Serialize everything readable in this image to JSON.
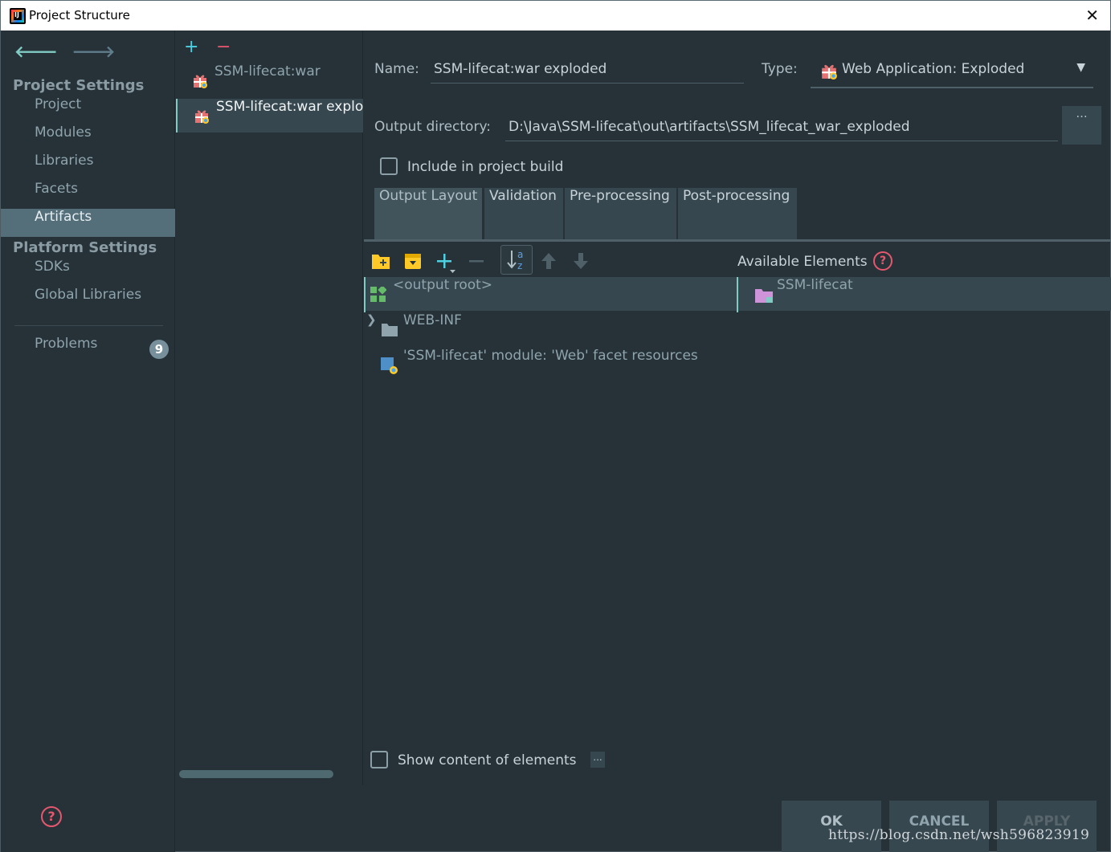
{
  "window": {
    "title": "Project Structure"
  },
  "sidebar": {
    "project_settings_title": "Project Settings",
    "project_items": [
      "Project",
      "Modules",
      "Libraries",
      "Facets",
      "Artifacts"
    ],
    "selected": "Artifacts",
    "platform_settings_title": "Platform Settings",
    "platform_items": [
      "SDKs",
      "Global Libraries"
    ],
    "problems_label": "Problems",
    "problems_count": "9"
  },
  "artifacts": {
    "add_glyph": "+",
    "remove_glyph": "−",
    "items": [
      "SSM-lifecat:war",
      "SSM-lifecat:war exploded"
    ]
  },
  "form": {
    "name_label": "Name:",
    "name_value": "SSM-lifecat:war exploded",
    "type_label": "Type:",
    "type_value": "Web Application: Exploded",
    "output_dir_label": "Output directory:",
    "output_dir_value": "D:\\Java\\SSM-lifecat\\out\\artifacts\\SSM_lifecat_war_exploded",
    "browse_label": "...",
    "include_label": "Include in project build",
    "include_checked": false
  },
  "tabs": [
    "Output Layout",
    "Validation",
    "Pre-processing",
    "Post-processing"
  ],
  "active_tab": "Output Layout",
  "layout": {
    "available_label": "Available Elements",
    "tree": [
      "<output root>",
      "WEB-INF",
      "'SSM-lifecat' module: 'Web' facet resources"
    ],
    "available": [
      "SSM-lifecat"
    ],
    "show_content_label": "Show content of elements",
    "show_content_checked": false,
    "dots_label": "..."
  },
  "buttons": {
    "ok": "OK",
    "cancel": "CANCEL",
    "apply": "APPLY"
  },
  "watermark": "https://blog.csdn.net/wsh596823919",
  "colors": {
    "background": "#263238",
    "selection": "#546e7a",
    "accent": "#80cbc4",
    "help_red": "#e5576e",
    "folder_yellow": "#ffca28",
    "folder_grey": "#90a4ae",
    "module_purple": "#ce93d8"
  }
}
